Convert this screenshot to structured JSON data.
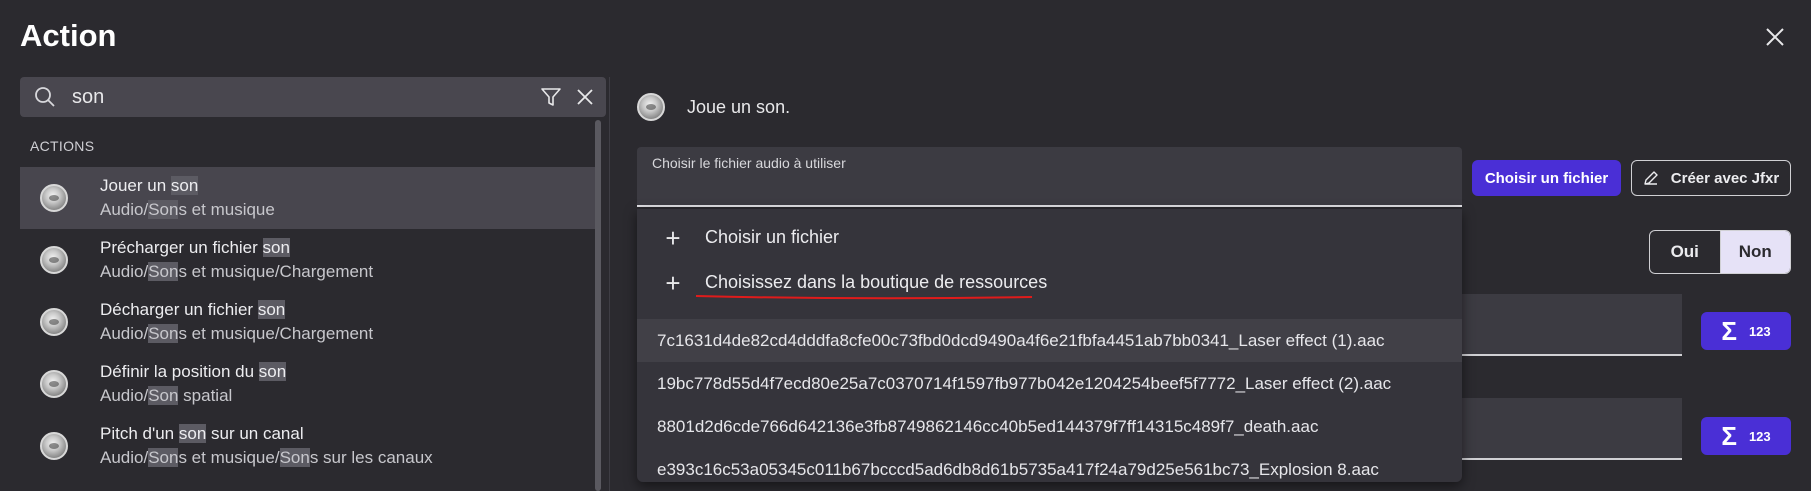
{
  "window": {
    "title": "Action"
  },
  "search": {
    "value": "son"
  },
  "actions_panel": {
    "section_header": "ACTIONS",
    "items": [
      {
        "name_before": "Jouer un ",
        "name_match": "son",
        "name_after": "",
        "path_before": "Audio/",
        "path_match": "Son",
        "path_after": "s et musique",
        "path_match2": "",
        "path_after2": ""
      },
      {
        "name_before": "Précharger un fichier ",
        "name_match": "son",
        "name_after": "",
        "path_before": "Audio/",
        "path_match": "Son",
        "path_after": "s et musique/Chargement",
        "path_match2": "",
        "path_after2": ""
      },
      {
        "name_before": "Décharger un fichier ",
        "name_match": "son",
        "name_after": "",
        "path_before": "Audio/",
        "path_match": "Son",
        "path_after": "s et musique/Chargement",
        "path_match2": "",
        "path_after2": ""
      },
      {
        "name_before": "Définir la position du ",
        "name_match": "son",
        "name_after": "",
        "path_before": "Audio/",
        "path_match": "Son",
        "path_after": " spatial",
        "path_match2": "",
        "path_after2": ""
      },
      {
        "name_before": "Pitch d'un ",
        "name_match": "son",
        "name_after": " sur un canal",
        "path_before": "Audio/",
        "path_match": "Son",
        "path_after": "s et musique/",
        "path_match2": "Son",
        "path_after2": "s sur les canaux"
      }
    ]
  },
  "detail": {
    "description": "Joue un son.",
    "audio_field_label": "Choisir le fichier audio à utiliser",
    "choose_file_button": "Choisir un fichier",
    "jfxr_button": "Créer avec Jfxr",
    "toggle": {
      "yes": "Oui",
      "no": "Non",
      "selected": "Non"
    },
    "expression_button_number": "123"
  },
  "dropdown": {
    "actions": [
      "Choisir un fichier",
      "Choisissez dans la boutique de ressources"
    ],
    "files": [
      "7c1631d4de82cd4dddfa8cfe00c73fbd0dcd9490a4f6e21fbfa4451ab7bb0341_Laser effect (1).aac",
      "19bc778d55d4f7ecd80e25a7c0370714f1597fb977b042e1204254beef5f7772_Laser effect (2).aac",
      "8801d2d6cde766d642136e3fb8749862146cc40b5ed144379f7ff14315c489f7_death.aac",
      "e393c16c53a05345c011b67bcccd5ad6db8d61b5735a417f24a79d25e561bc73_Explosion 8.aac"
    ]
  },
  "colors": {
    "accent": "#4a2fd6",
    "background": "#2b2a2f",
    "annotation": "#e01b1b"
  }
}
